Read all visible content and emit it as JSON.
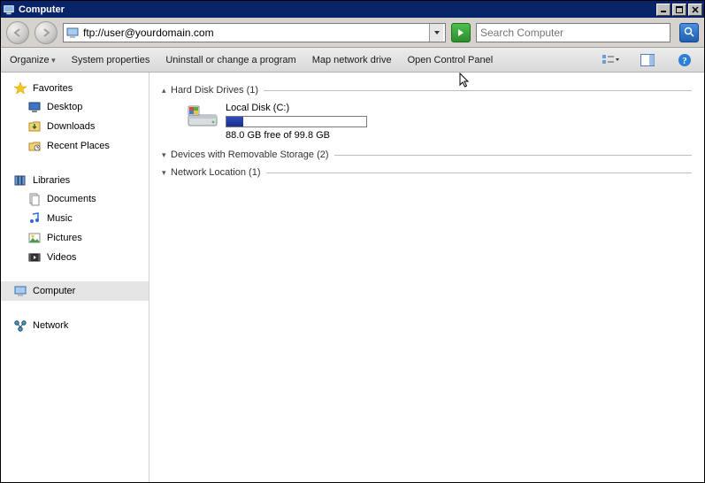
{
  "window": {
    "title": "Computer"
  },
  "nav": {
    "address": "ftp://user@yourdomain.com",
    "search_placeholder": "Search Computer"
  },
  "cmd": {
    "organize": "Organize",
    "sysprop": "System properties",
    "uninstall": "Uninstall or change a program",
    "mapdrive": "Map network drive",
    "controlpanel": "Open Control Panel"
  },
  "sidebar": {
    "favorites_label": "Favorites",
    "favorites": [
      {
        "label": "Desktop"
      },
      {
        "label": "Downloads"
      },
      {
        "label": "Recent Places"
      }
    ],
    "libraries_label": "Libraries",
    "libraries": [
      {
        "label": "Documents"
      },
      {
        "label": "Music"
      },
      {
        "label": "Pictures"
      },
      {
        "label": "Videos"
      }
    ],
    "computer_label": "Computer",
    "network_label": "Network"
  },
  "sections": {
    "hdd": "Hard Disk Drives (1)",
    "removable": "Devices with Removable Storage (2)",
    "network": "Network Location (1)"
  },
  "drive": {
    "name": "Local Disk (C:)",
    "free_text": "88.0 GB free of 99.8 GB",
    "used_percent": 12
  }
}
